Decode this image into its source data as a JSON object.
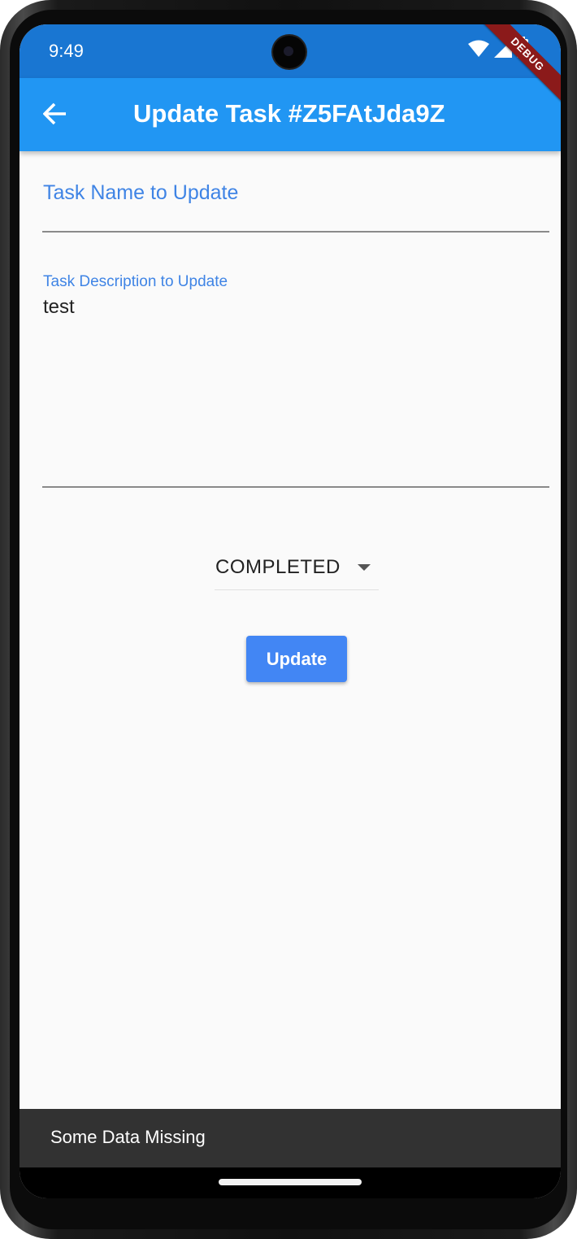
{
  "status_bar": {
    "time": "9:49",
    "icons": [
      "wifi-icon",
      "cellular-signal-icon",
      "battery-icon"
    ]
  },
  "debug_banner": "DEBUG",
  "app_bar": {
    "back_icon": "arrow-back-icon",
    "title": "Update Task #Z5FAtJda9Z"
  },
  "form": {
    "task_name": {
      "label": "Task Name to Update",
      "value": ""
    },
    "task_description": {
      "label": "Task Description to Update",
      "value": "test"
    },
    "status_dropdown": {
      "selected": "COMPLETED",
      "icon": "dropdown-arrow-icon"
    },
    "update_button": "Update"
  },
  "snackbar": {
    "message": "Some Data Missing"
  },
  "colors": {
    "status_bar": "#1976d2",
    "app_bar": "#2196f3",
    "accent": "#4286f4",
    "label": "#3f84e5",
    "snackbar": "#323232",
    "background": "#fafafa"
  }
}
